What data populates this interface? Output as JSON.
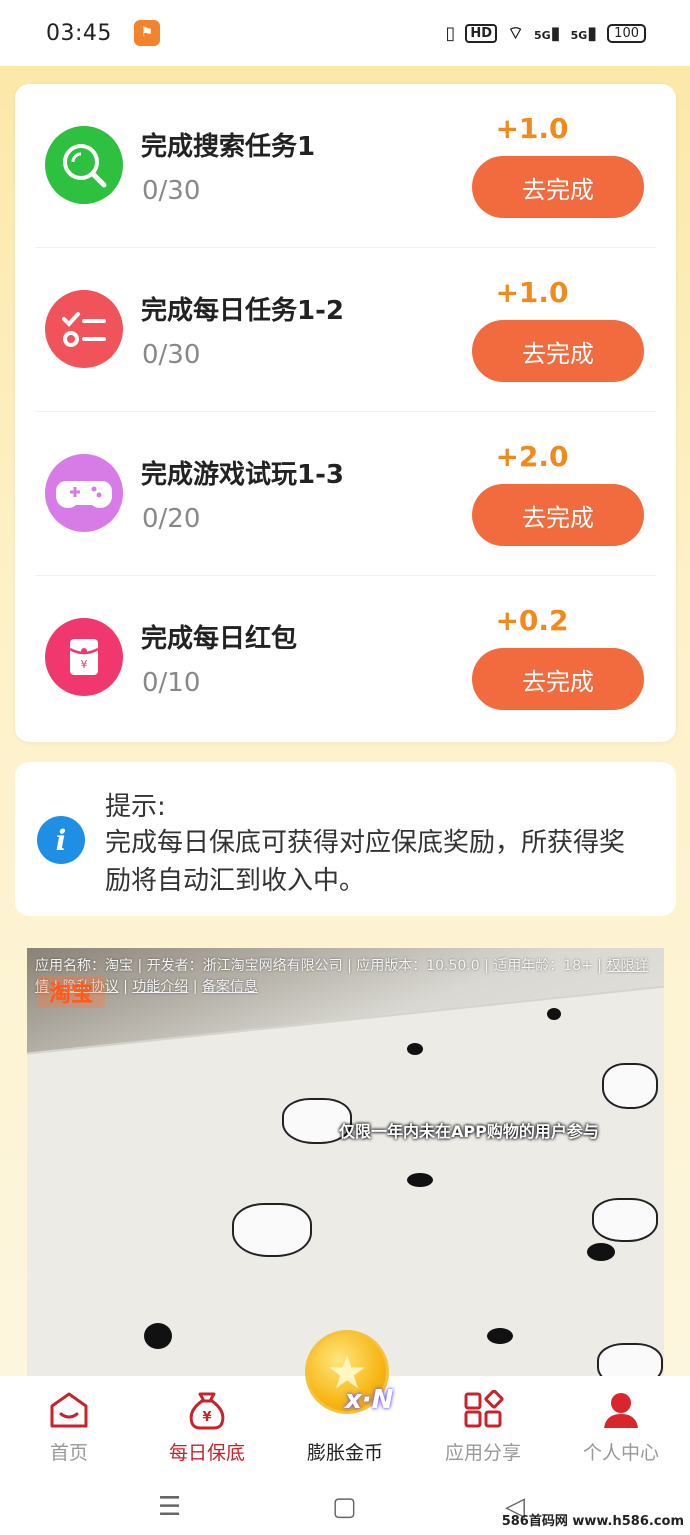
{
  "status_bar": {
    "time": "03:45",
    "app_icon": "app-badge-icon",
    "hd_label": "HD",
    "signal_1": "5G",
    "signal_2": "5G",
    "battery": "100"
  },
  "tasks": [
    {
      "title": "完成搜索任务1",
      "progress": "0/30",
      "reward": "+1.0",
      "button": "去完成",
      "icon": "search-icon",
      "color": "#2dc13f"
    },
    {
      "title": "完成每日任务1-2",
      "progress": "0/30",
      "reward": "+1.0",
      "button": "去完成",
      "icon": "checklist-icon",
      "color": "#f0535a"
    },
    {
      "title": "完成游戏试玩1-3",
      "progress": "0/20",
      "reward": "+2.0",
      "button": "去完成",
      "icon": "gamepad-icon",
      "color": "#d77be6"
    },
    {
      "title": "完成每日红包",
      "progress": "0/10",
      "reward": "+0.2",
      "button": "去完成",
      "icon": "red-envelope-icon",
      "color": "#f0386e"
    }
  ],
  "tip": {
    "title": "提示:",
    "body": "完成每日保底可获得对应保底奖励，所获得奖励将自动汇到收入中。"
  },
  "ad": {
    "info_prefix": "应用名称：淘宝 | 开发者：浙江淘宝网络有限公司 | 应用版本：10.50.0 | 适用年龄：18+ | ",
    "link_permissions": "权限详情",
    "link_privacy": "隐私协议",
    "link_features": "功能介绍",
    "link_filing": "备案信息",
    "brand": "淘宝",
    "caption": "仅限一年内未在APP购物的用户参与"
  },
  "bottom_nav": {
    "items": [
      {
        "label": "首页",
        "icon": "home-icon"
      },
      {
        "label": "每日保底",
        "icon": "money-bag-icon"
      },
      {
        "label": "膨胀金币",
        "icon": "coin-icon"
      },
      {
        "label": "应用分享",
        "icon": "apps-grid-icon"
      },
      {
        "label": "个人中心",
        "icon": "person-icon"
      }
    ],
    "coin_badge": "x·N"
  },
  "watermark": "586首码网 www.h586.com"
}
